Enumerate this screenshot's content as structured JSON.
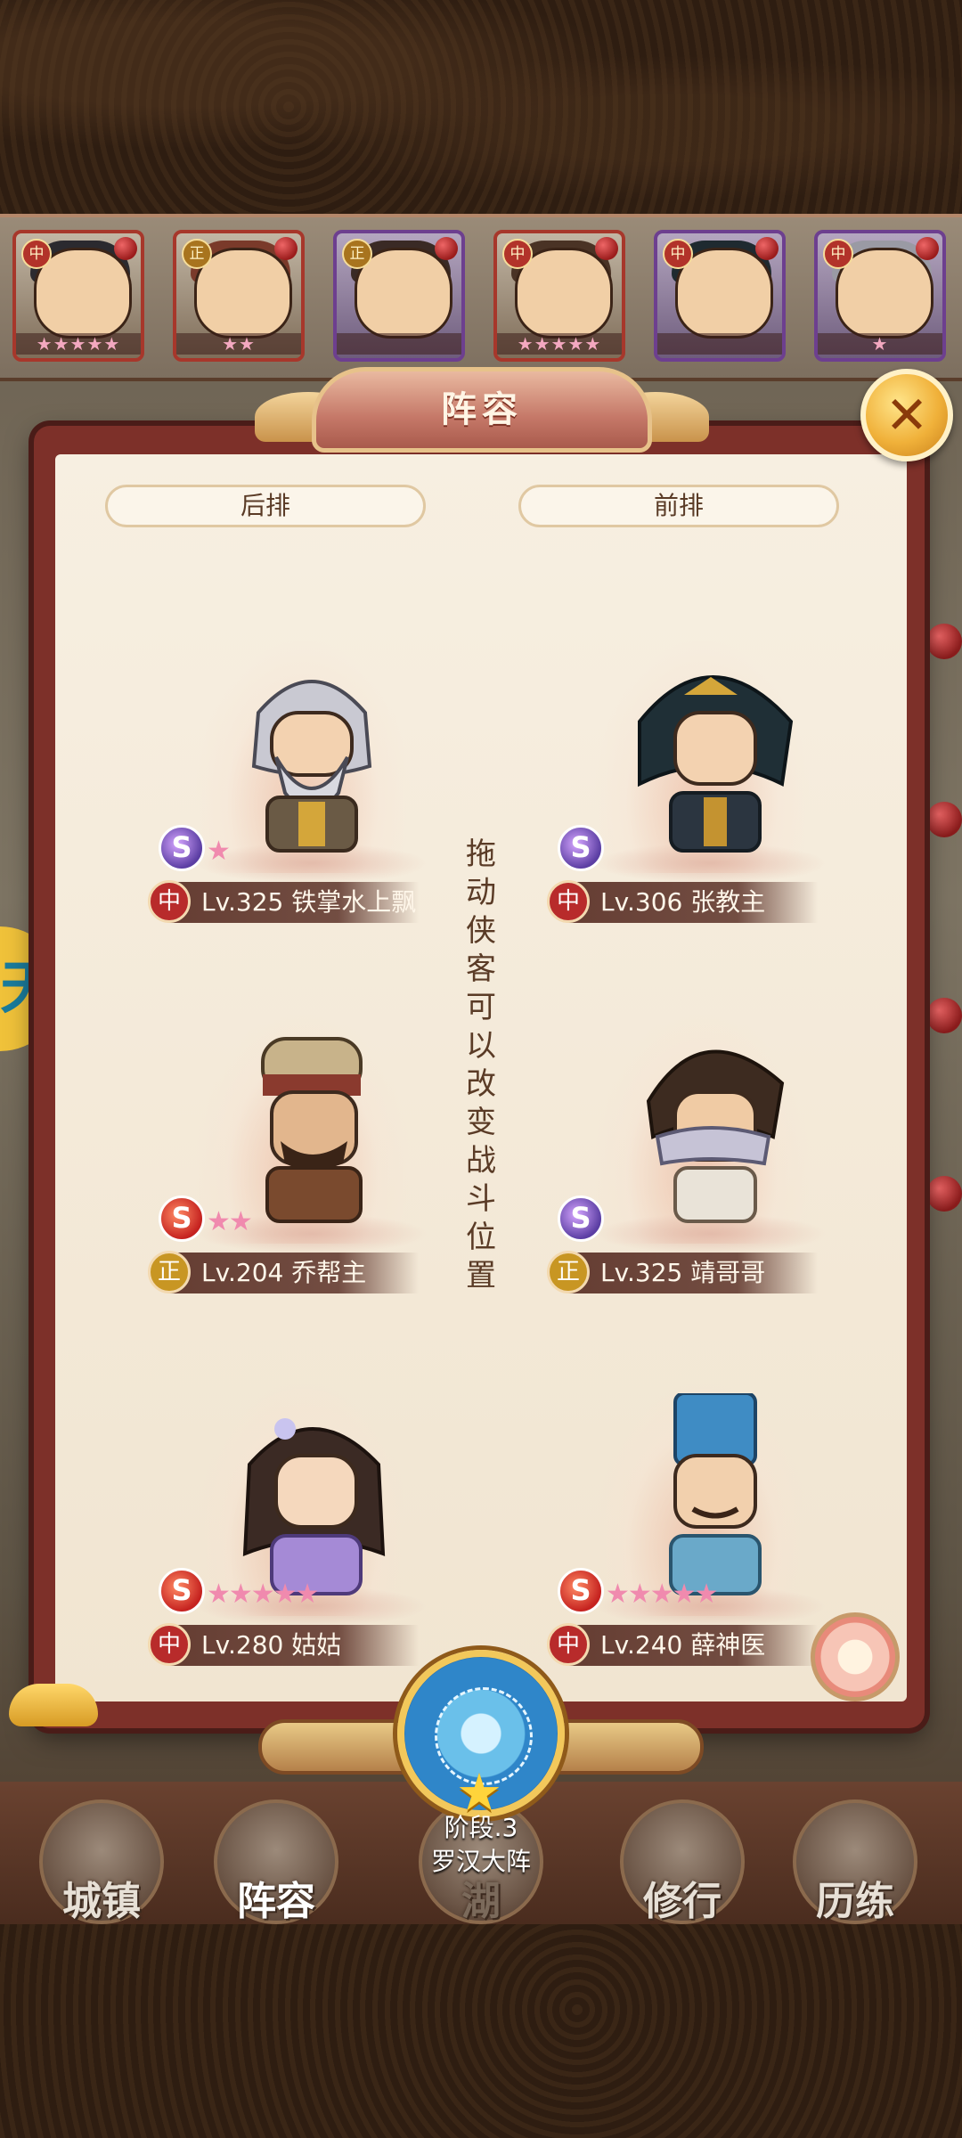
{
  "hero_strip": [
    {
      "tag": "中",
      "stars": "★★★★★",
      "variant": "red"
    },
    {
      "tag": "正",
      "stars": "★★",
      "variant": "red"
    },
    {
      "tag": "正",
      "stars": "",
      "variant": "purple"
    },
    {
      "tag": "中",
      "stars": "★★★★★",
      "variant": "red"
    },
    {
      "tag": "中",
      "stars": "",
      "variant": "purple"
    },
    {
      "tag": "中",
      "stars": "★",
      "variant": "purple"
    }
  ],
  "dialog": {
    "title": "阵容",
    "close_glyph": "✕",
    "back_row_label": "后排",
    "front_row_label": "前排",
    "hint": "拖动侠客可以改变战斗位置",
    "slots": [
      {
        "camp": "中",
        "level": "Lv.325",
        "name": "铁掌水上飘",
        "stars": "★",
        "emblem": "S",
        "emblem_style": "purple",
        "row": "后排"
      },
      {
        "camp": "中",
        "level": "Lv.306",
        "name": "张教主",
        "stars": "",
        "emblem": "S",
        "emblem_style": "purple",
        "row": "前排"
      },
      {
        "camp": "正",
        "level": "Lv.204",
        "name": "乔帮主",
        "stars": "★★",
        "emblem": "S",
        "emblem_style": "red",
        "row": "后排"
      },
      {
        "camp": "正",
        "level": "Lv.325",
        "name": "靖哥哥",
        "stars": "",
        "emblem": "S",
        "emblem_style": "purple",
        "row": "前排"
      },
      {
        "camp": "中",
        "level": "Lv.280",
        "name": "姑姑",
        "stars": "★★★★★",
        "emblem": "S",
        "emblem_style": "red",
        "row": "后排"
      },
      {
        "camp": "中",
        "level": "Lv.240",
        "name": "薛神医",
        "stars": "★★★★★",
        "emblem": "S",
        "emblem_style": "red",
        "row": "前排"
      }
    ]
  },
  "formation": {
    "stage": "阶段.3",
    "name": "罗汉大阵",
    "star": "★"
  },
  "bottom_nav": [
    {
      "label": "城镇",
      "active": false
    },
    {
      "label": "阵容",
      "active": true
    },
    {
      "label": "湖",
      "active": false
    },
    {
      "label": "修行",
      "active": false
    },
    {
      "label": "历练",
      "active": false
    }
  ],
  "side_badge": "天",
  "colors": {
    "dialog_frame": "#7d3029",
    "dialog_paper": "#f7efe1",
    "title_text": "#fff5e5",
    "name_plate": "#5c3228",
    "star_pink": "#f08aae",
    "medallion_blue": "#2f86c9"
  }
}
